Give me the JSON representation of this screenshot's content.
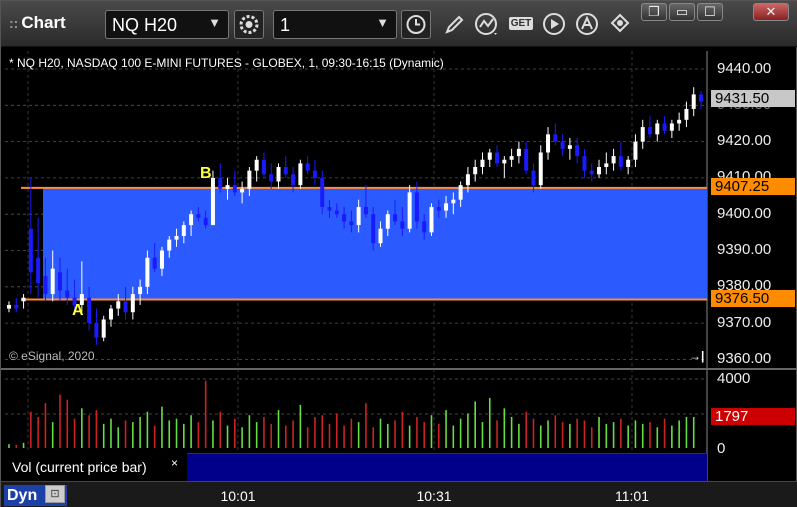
{
  "toolbar": {
    "title_prefix": "::",
    "title": "Chart",
    "symbol": "NQ H20",
    "interval": "1",
    "get_label": "GET"
  },
  "window_controls": {
    "restore": "❐",
    "minimize": "▭",
    "maximize": "☐",
    "close": "✕"
  },
  "chart": {
    "header": "* NQ H20, NASDAQ 100 E-MINI FUTURES - GLOBEX, 1, 09:30-16:15 (Dynamic)",
    "copyright": "© eSignal, 2020",
    "price_ticks": [
      "9440.00",
      "9430.00",
      "9420.00",
      "9410.00",
      "9400.00",
      "9390.00",
      "9380.00",
      "9370.00",
      "9360.00"
    ],
    "price_tag": "9431.50",
    "zone_top_tag": "9407.25",
    "zone_bottom_tag": "9376.50",
    "label_a": "A",
    "label_b": "B",
    "scroll_end_icon": "→|"
  },
  "volume": {
    "legend": "Vol (current price bar)",
    "close_label": "×",
    "ticks": [
      "4000",
      "2000",
      "0"
    ],
    "value_tag": "1797"
  },
  "status": {
    "mode": "Dyn",
    "time_labels": [
      "10:01",
      "10:31",
      "11:01"
    ]
  },
  "colors": {
    "zone": "#2b5bff",
    "zone_line": "#ff8c3a",
    "up_bar": "#ffffff",
    "down_bar": "#1a1aff",
    "vol_up": "#66dd44",
    "vol_down": "#cc2222",
    "price_tag_bg": "#c8c8c8",
    "zone_tag_bg": "#ff8c00",
    "vol_tag_bg": "#cc0000"
  },
  "chart_data": {
    "type": "candlestick",
    "zone": {
      "top": 9407.25,
      "bottom": 9376.5
    },
    "ylim": [
      9360,
      9445
    ],
    "candles": [
      [
        9374,
        9376,
        9373,
        9375
      ],
      [
        9375,
        9377,
        9373,
        9374
      ],
      [
        9376,
        9378,
        9374,
        9377
      ],
      [
        9396,
        9410,
        9378,
        9384
      ],
      [
        9388,
        9399,
        9377,
        9381
      ],
      [
        9383,
        9388,
        9376,
        9378
      ],
      [
        9378,
        9390,
        9376,
        9385
      ],
      [
        9384,
        9388,
        9376,
        9379
      ],
      [
        9379,
        9385,
        9375,
        9377
      ],
      [
        9377,
        9382,
        9373,
        9375
      ],
      [
        9375,
        9387,
        9373,
        9378
      ],
      [
        9377,
        9380,
        9368,
        9370
      ],
      [
        9370,
        9374,
        9364,
        9366
      ],
      [
        9366,
        9372,
        9365,
        9371
      ],
      [
        9371,
        9375,
        9369,
        9374
      ],
      [
        9374,
        9378,
        9372,
        9376
      ],
      [
        9376,
        9380,
        9371,
        9373
      ],
      [
        9373,
        9380,
        9371,
        9378
      ],
      [
        9378,
        9382,
        9375,
        9380
      ],
      [
        9380,
        9390,
        9378,
        9388
      ],
      [
        9388,
        9392,
        9384,
        9385
      ],
      [
        9385,
        9391,
        9383,
        9390
      ],
      [
        9390,
        9394,
        9388,
        9393
      ],
      [
        9393,
        9396,
        9391,
        9394
      ],
      [
        9394,
        9398,
        9392,
        9397
      ],
      [
        9397,
        9401,
        9394,
        9400
      ],
      [
        9400,
        9402,
        9398,
        9399
      ],
      [
        9399,
        9401,
        9396,
        9397
      ],
      [
        9397,
        9412,
        9397,
        9410
      ],
      [
        9410,
        9414,
        9406,
        9407
      ],
      [
        9407,
        9410,
        9404,
        9408
      ],
      [
        9408,
        9412,
        9405,
        9406
      ],
      [
        9406,
        9409,
        9403,
        9407
      ],
      [
        9407,
        9413,
        9405,
        9412
      ],
      [
        9412,
        9416,
        9409,
        9415
      ],
      [
        9415,
        9417,
        9410,
        9411
      ],
      [
        9411,
        9414,
        9407,
        9409
      ],
      [
        9409,
        9414,
        9407,
        9413
      ],
      [
        9413,
        9416,
        9410,
        9411
      ],
      [
        9411,
        9413,
        9406,
        9408
      ],
      [
        9408,
        9415,
        9407,
        9414
      ],
      [
        9414,
        9416,
        9411,
        9412
      ],
      [
        9412,
        9415,
        9408,
        9410
      ],
      [
        9410,
        9412,
        9400,
        9402
      ],
      [
        9402,
        9404,
        9399,
        9401
      ],
      [
        9401,
        9403,
        9399,
        9400
      ],
      [
        9400,
        9402,
        9396,
        9398
      ],
      [
        9398,
        9401,
        9395,
        9397
      ],
      [
        9397,
        9404,
        9395,
        9402
      ],
      [
        9402,
        9408,
        9399,
        9400
      ],
      [
        9400,
        9402,
        9390,
        9392
      ],
      [
        9392,
        9398,
        9391,
        9396
      ],
      [
        9396,
        9401,
        9394,
        9400
      ],
      [
        9400,
        9404,
        9397,
        9398
      ],
      [
        9398,
        9402,
        9394,
        9396
      ],
      [
        9396,
        9408,
        9395,
        9406
      ],
      [
        9406,
        9409,
        9396,
        9398
      ],
      [
        9398,
        9400,
        9393,
        9395
      ],
      [
        9395,
        9403,
        9394,
        9402
      ],
      [
        9402,
        9404,
        9399,
        9401
      ],
      [
        9401,
        9405,
        9399,
        9403
      ],
      [
        9403,
        9406,
        9400,
        9404
      ],
      [
        9404,
        9409,
        9402,
        9408
      ],
      [
        9408,
        9413,
        9406,
        9411
      ],
      [
        9411,
        9415,
        9409,
        9413
      ],
      [
        9413,
        9417,
        9411,
        9415
      ],
      [
        9415,
        9418,
        9413,
        9417
      ],
      [
        9417,
        9419,
        9413,
        9414
      ],
      [
        9414,
        9416,
        9410,
        9415
      ],
      [
        9415,
        9418,
        9413,
        9416
      ],
      [
        9416,
        9420,
        9414,
        9418
      ],
      [
        9418,
        9420,
        9411,
        9412
      ],
      [
        9412,
        9414,
        9406,
        9408
      ],
      [
        9408,
        9419,
        9407,
        9417
      ],
      [
        9417,
        9424,
        9415,
        9422
      ],
      [
        9422,
        9425,
        9419,
        9420
      ],
      [
        9420,
        9422,
        9416,
        9418
      ],
      [
        9418,
        9421,
        9415,
        9419
      ],
      [
        9419,
        9421,
        9414,
        9416
      ],
      [
        9416,
        9418,
        9410,
        9412
      ],
      [
        9412,
        9414,
        9409,
        9411
      ],
      [
        9411,
        9415,
        9410,
        9413
      ],
      [
        9413,
        9417,
        9411,
        9414
      ],
      [
        9414,
        9418,
        9412,
        9416
      ],
      [
        9416,
        9420,
        9412,
        9413
      ],
      [
        9413,
        9416,
        9411,
        9415
      ],
      [
        9415,
        9422,
        9413,
        9420
      ],
      [
        9420,
        9426,
        9418,
        9424
      ],
      [
        9424,
        9427,
        9421,
        9422
      ],
      [
        9422,
        9426,
        9420,
        9425
      ],
      [
        9425,
        9427,
        9422,
        9423
      ],
      [
        9423,
        9426,
        9421,
        9425
      ],
      [
        9425,
        9428,
        9423,
        9426
      ],
      [
        9426,
        9431,
        9424,
        9429
      ],
      [
        9429,
        9435,
        9427,
        9433
      ],
      [
        9433,
        9434,
        9429,
        9431
      ]
    ],
    "volume": [
      220,
      180,
      300,
      2100,
      1800,
      2600,
      1500,
      3100,
      2800,
      1700,
      2300,
      1900,
      2200,
      1400,
      1700,
      1200,
      1600,
      1500,
      1800,
      2100,
      1300,
      2400,
      1600,
      1700,
      1400,
      1900,
      1500,
      3900,
      1600,
      2100,
      1300,
      1700,
      1200,
      1900,
      1500,
      1800,
      1400,
      2200,
      1300,
      1600,
      2500,
      1200,
      1800,
      1900,
      1400,
      2000,
      1300,
      1700,
      1500,
      2600,
      1200,
      1700,
      1400,
      1600,
      2100,
      1300,
      1800,
      1500,
      1900,
      1400,
      2200,
      1300,
      1700,
      2000,
      2700,
      1500,
      2900,
      1600,
      2300,
      1800,
      1400,
      2100,
      1700,
      1300,
      1600,
      1900,
      1500,
      1400,
      1700,
      1600,
      1200,
      1800,
      1400,
      1500,
      1700,
      1300,
      1600,
      1400,
      1500,
      1200,
      1700,
      1300,
      1600,
      1800,
      1797
    ]
  }
}
